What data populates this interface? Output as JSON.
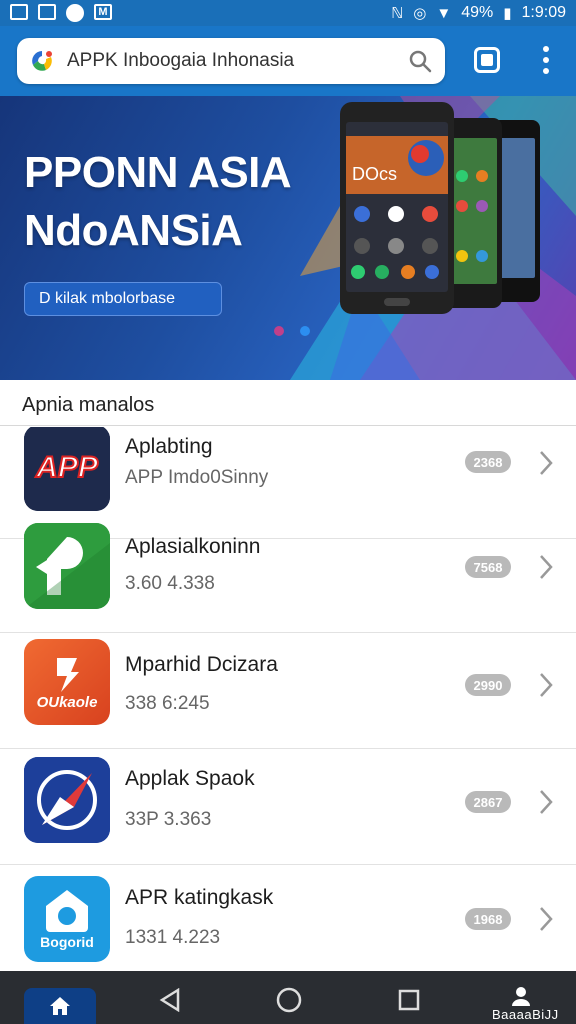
{
  "status_bar": {
    "battery": "49%",
    "time": "1:9:09"
  },
  "header": {
    "search_text": "APPK Inboogaia Inhonasia",
    "search_icon": "search-icon",
    "tabs_icon": "tabs-icon",
    "more_icon": "more-vert-icon"
  },
  "banner": {
    "title_line1": "PPONN ASIA",
    "title_line2": "NdoANSiA",
    "button_label": "D kilak mbolorbase",
    "dot_colors": [
      "#c0408a",
      "#2c8ef0"
    ]
  },
  "section": {
    "title": "Apnia manalos"
  },
  "apps": [
    {
      "name": "Aplabting",
      "sub": "APP Imdo0Sinny",
      "badge": "2368",
      "icon_text": "APP",
      "icon_color": "#1e2a4c"
    },
    {
      "name": "Aplasialkoninn",
      "sub": "3.60 4.338",
      "badge": "7568",
      "icon_text": "",
      "icon_color": "#2e9c3e"
    },
    {
      "name": "Mparhid Dcizara",
      "sub": "338 6:245",
      "badge": "2990",
      "icon_text": "OUkaole",
      "icon_color": "#e8512a"
    },
    {
      "name": "Applak Spaok",
      "sub": "33P 3.363",
      "badge": "2867",
      "icon_text": "",
      "icon_color": "#1d3f9a"
    },
    {
      "name": "APR katingkask",
      "sub": "1331 4.223",
      "badge": "1968",
      "icon_text": "Bogorid",
      "icon_color": "#1e9be0"
    }
  ],
  "navbar": {
    "home_icon": "home-icon",
    "back_icon": "back-icon",
    "circle_icon": "home-circle-icon",
    "recents_icon": "recents-icon",
    "profile_icon": "person-icon",
    "profile_label": "BaaaaBiJJ"
  }
}
